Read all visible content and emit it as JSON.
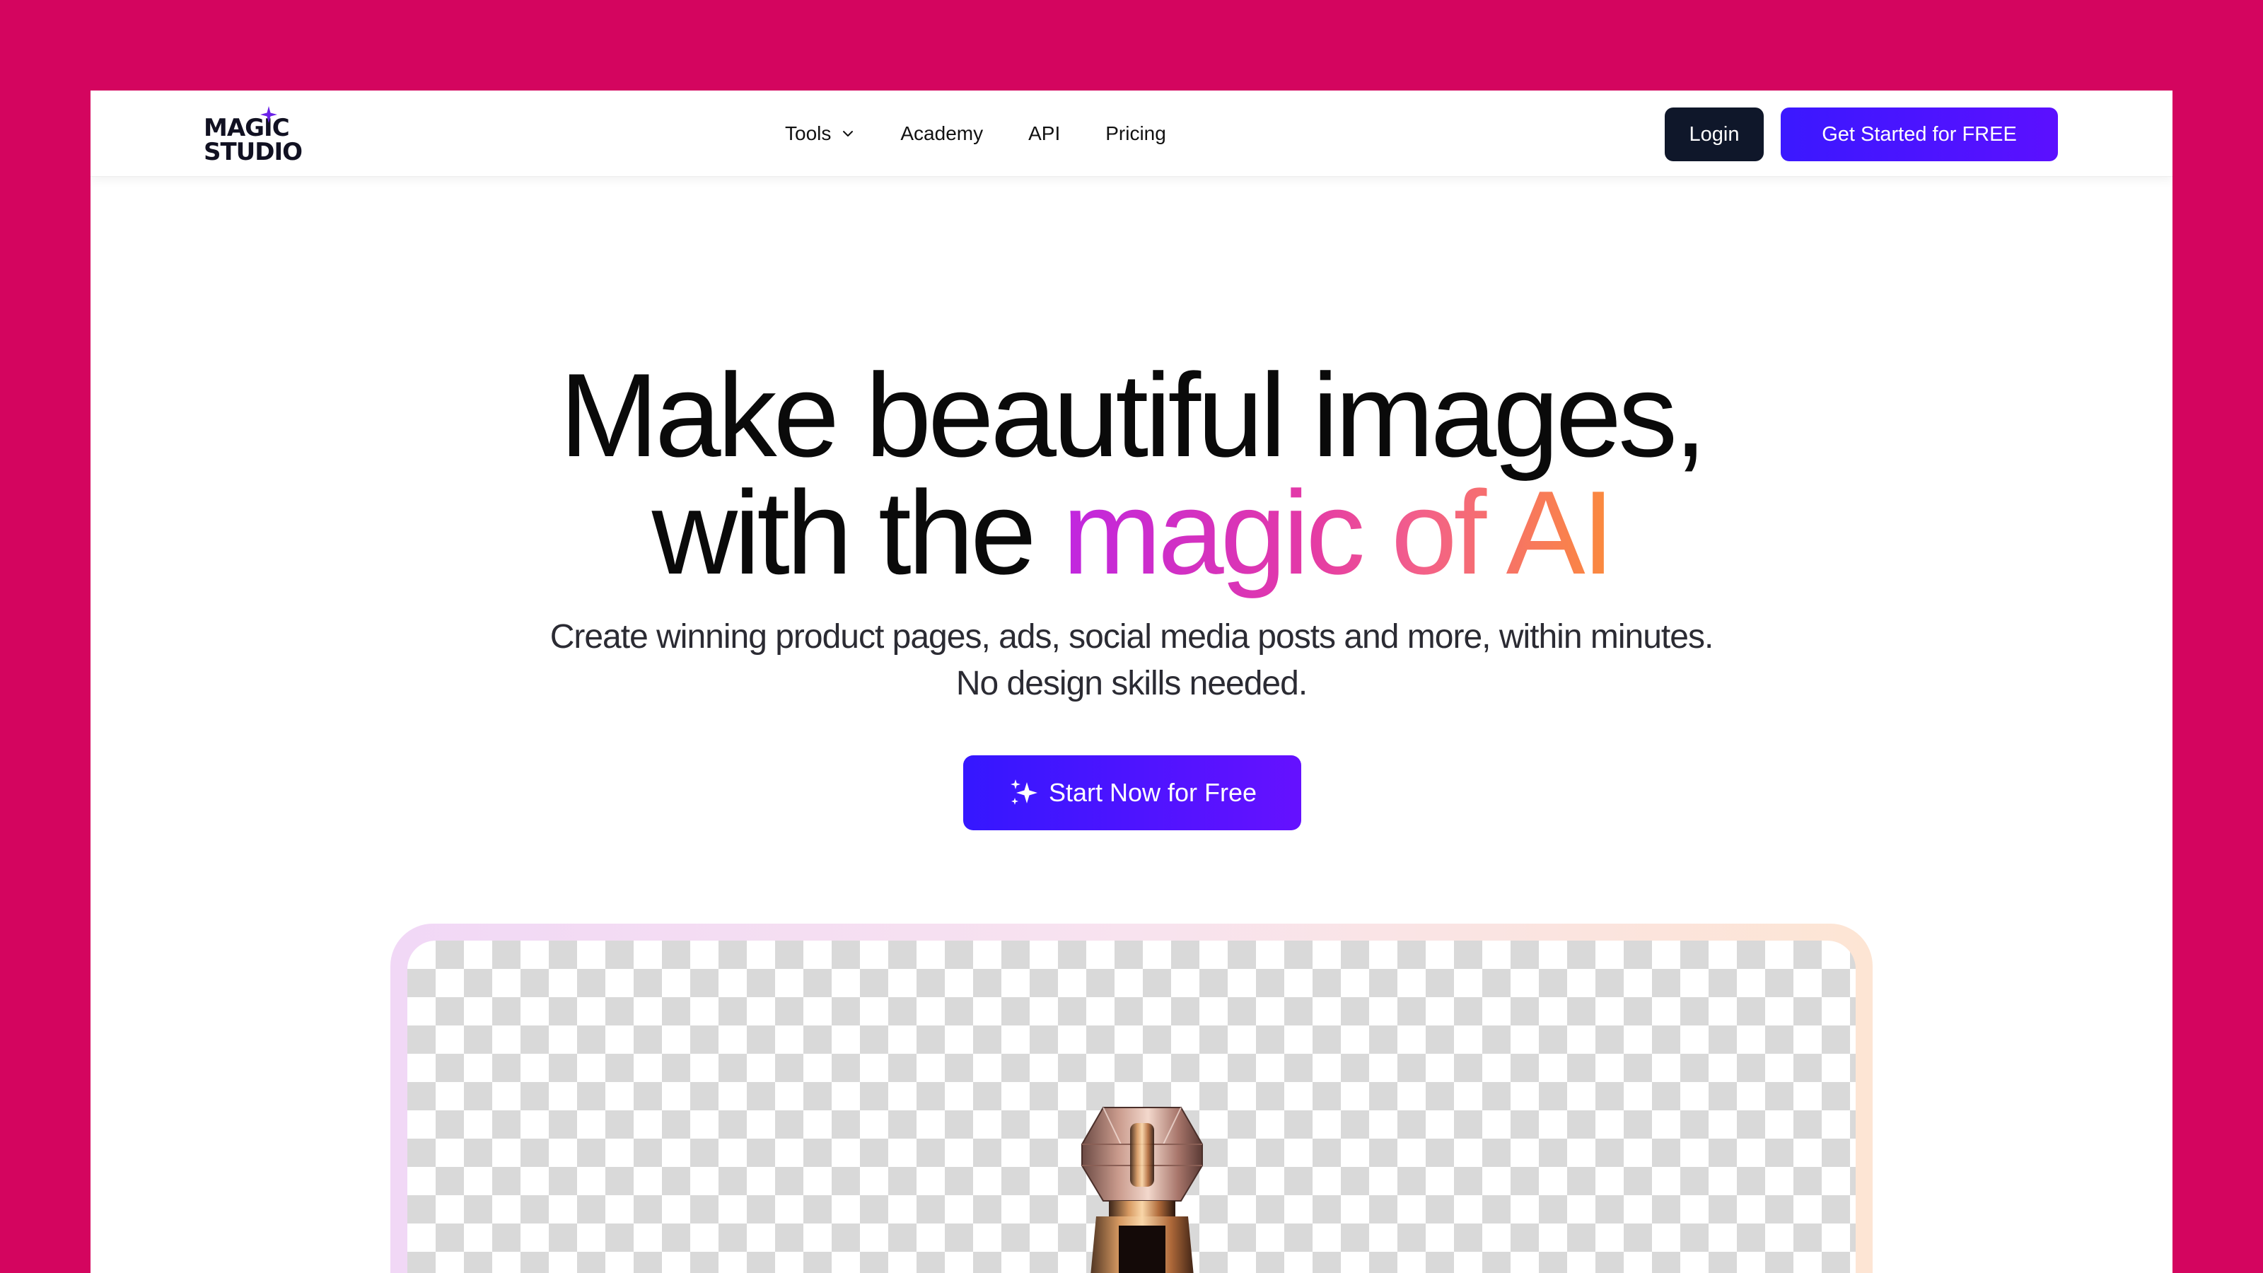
{
  "brand": {
    "logo_line1": "MAGIC",
    "logo_line2": "STUDIO",
    "accent_color": "#5b10ff",
    "background_color": "#d4055f"
  },
  "nav": {
    "links": [
      {
        "label": "Tools",
        "has_dropdown": true
      },
      {
        "label": "Academy"
      },
      {
        "label": "API"
      },
      {
        "label": "Pricing"
      }
    ],
    "login_label": "Login",
    "cta_label": "Get Started for FREE"
  },
  "hero": {
    "title_line1": "Make beautiful images,",
    "title_line2_plain": "with the ",
    "title_line2_gradient": "magic of AI",
    "subtitle_line1": "Create winning product pages, ads, social media posts and more, within minutes.",
    "subtitle_line2": "No design skills needed.",
    "cta_label": "Start Now for Free"
  },
  "icons": [
    "chevron-down-icon",
    "sparkle-icon"
  ]
}
